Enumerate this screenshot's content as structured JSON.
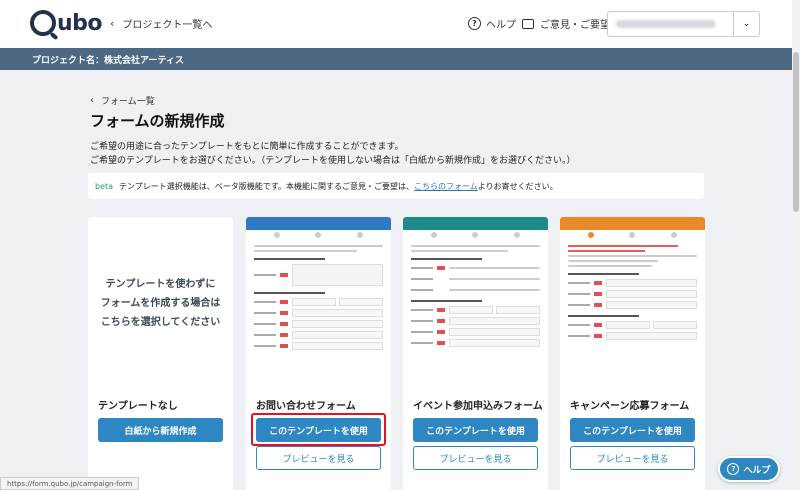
{
  "header": {
    "back_label": "プロジェクト一覧へ",
    "help_label": "ヘルプ",
    "feedback_label": "ご意見・ご要望"
  },
  "project_bar": {
    "label": "プロジェクト名：株式会社アーティス"
  },
  "breadcrumb": {
    "label": "フォーム一覧"
  },
  "page": {
    "title": "フォームの新規作成",
    "desc1": "ご希望の用途に合ったテンプレートをもとに簡単に作成することができます。",
    "desc2": "ご希望のテンプレートをお選びください。（テンプレートを使用しない場合は「白紙から新規作成」をお選びください。）"
  },
  "notice": {
    "beta": "beta",
    "text": "テンプレート選択機能は、ベータ版機能です。本機能に関するご意見・ご要望は、",
    "link": "こちらのフォーム",
    "suffix": "よりお寄せください。"
  },
  "cards": [
    {
      "blank_text_1": "テンプレートを使わずに",
      "blank_text_2": "フォームを作成する場合は",
      "blank_text_3": "こちらを選択してください",
      "label": "テンプレートなし",
      "primary": "白紙から新規作成"
    },
    {
      "label": "お問い合わせフォーム",
      "primary": "このテンプレートを使用",
      "secondary": "プレビューを見る",
      "head_color": "#2e7bc4"
    },
    {
      "label": "イベント参加申込みフォーム",
      "primary": "このテンプレートを使用",
      "secondary": "プレビューを見る",
      "head_color": "#1f8a8a"
    },
    {
      "label": "キャンペーン応募フォーム",
      "primary": "このテンプレートを使用",
      "secondary": "プレビューを見る",
      "head_color": "#e98a2a"
    }
  ],
  "help_fab": {
    "label": "ヘルプ"
  },
  "status_url": "https://form.qubo.jp/campaign-form"
}
